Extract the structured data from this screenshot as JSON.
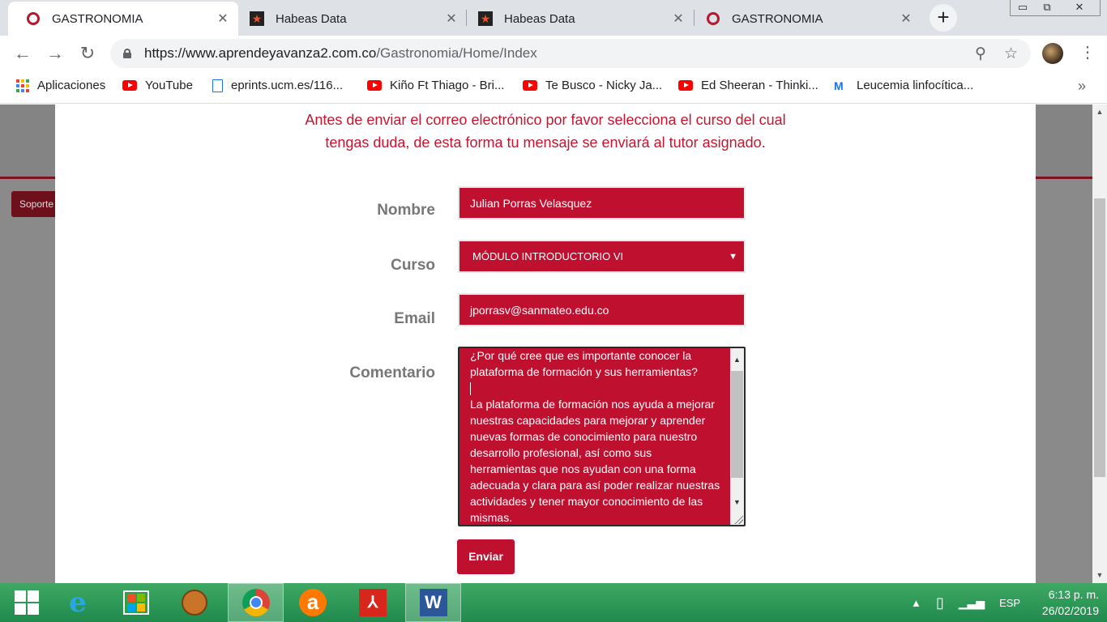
{
  "tabs": [
    {
      "title": "GASTRONOMIA",
      "icon": "gastronomia-icon",
      "active": true
    },
    {
      "title": "Habeas Data",
      "icon": "star-icon",
      "active": false
    },
    {
      "title": "Habeas Data",
      "icon": "star-icon",
      "active": false
    },
    {
      "title": "GASTRONOMIA",
      "icon": "gastronomia-icon",
      "active": false
    }
  ],
  "tab_close": "✕",
  "new_tab": "+",
  "window_controls": {
    "minimize": "▭",
    "restore": "⧉",
    "close": "✕"
  },
  "address": {
    "url_host": "https://www.aprendeyavanza2.com.co",
    "url_path": "/Gastronomia/Home/Index"
  },
  "bookmarks": [
    {
      "label": "Aplicaciones",
      "icon": "apps-icon"
    },
    {
      "label": "YouTube",
      "icon": "youtube-icon"
    },
    {
      "label": "eprints.ucm.es/116...",
      "icon": "document-icon"
    },
    {
      "label": "Kiño Ft Thiago - Bri...",
      "icon": "youtube-icon"
    },
    {
      "label": "Te Busco - Nicky Ja...",
      "icon": "youtube-icon"
    },
    {
      "label": "Ed Sheeran - Thinki...",
      "icon": "youtube-icon"
    },
    {
      "label": "Leucemia linfocítica...",
      "icon": "medical-icon"
    }
  ],
  "bookmarks_more": "»",
  "page": {
    "soporte_label": "Soporte",
    "intro_line1": "Antes de enviar el correo electrónico por favor selecciona el curso del cual",
    "intro_line2": "tengas duda, de esta forma tu mensaje se enviará al tutor asignado.",
    "form": {
      "nombre_label": "Nombre",
      "nombre_value": "Julian Porras Velasquez",
      "curso_label": "Curso",
      "curso_value": "MÓDULO INTRODUCTORIO VI",
      "email_label": "Email",
      "email_value": "jporrasv@sanmateo.edu.co",
      "comentario_label": "Comentario",
      "comentario_line1": "¿Por qué cree que es importante conocer la\nplataforma de formación y sus herramientas?\n",
      "comentario_line2": "\nLa plataforma de formación nos ayuda a mejorar\nnuestras capacidades para mejorar y aprender\nnuevas formas de conocimiento para nuestro\ndesarrollo profesional, así como sus\nherramientas que nos ayudan con una forma\nadecuada y clara para así poder realizar nuestras\nactividades y tener mayor conocimiento de las\nmismas.",
      "submit_label": "Enviar"
    }
  },
  "taskbar": {
    "apps": [
      "start-icon",
      "internet-explorer-icon",
      "store-icon",
      "mitt-icon",
      "chrome-icon",
      "avast-icon",
      "acrobat-icon",
      "word-icon"
    ],
    "tray_lang": "ESP",
    "time": "6:13 p. m.",
    "date": "26/02/2019"
  },
  "colors": {
    "brand_red": "#bf1030",
    "intro_red": "#c8142f",
    "taskbar_green": "#2a9a56"
  }
}
